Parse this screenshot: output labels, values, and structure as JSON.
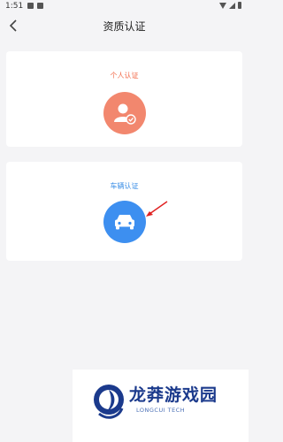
{
  "status_bar": {
    "time": "1:51"
  },
  "header": {
    "title": "资质认证"
  },
  "cards": [
    {
      "label": "个人认证",
      "icon": "user-verified-icon",
      "color": "#f2876e"
    },
    {
      "label": "车辆认证",
      "icon": "car-icon",
      "color": "#3d8ff0"
    }
  ],
  "watermark": {
    "title": "龙莽游戏园",
    "subtitle": "LONGCUI TECH"
  }
}
